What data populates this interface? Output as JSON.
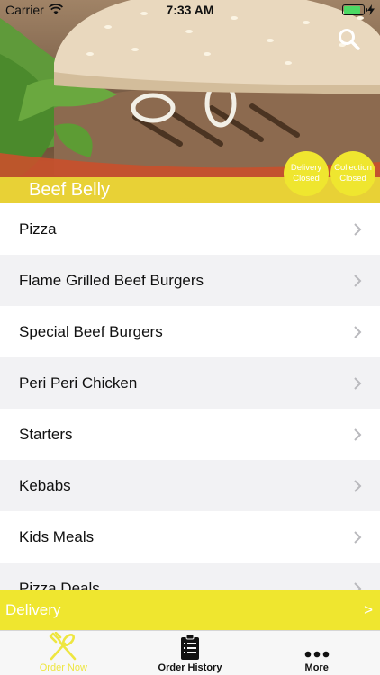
{
  "status_bar": {
    "carrier": "Carrier",
    "time": "7:33 AM"
  },
  "header": {
    "restaurant_name": "Beef Belly",
    "delivery_badge": {
      "line1": "Delivery",
      "line2": "Closed"
    },
    "collection_badge": {
      "line1": "Collection",
      "line2": "Closed"
    },
    "search_icon": "search-icon"
  },
  "menu": {
    "items": [
      {
        "label": "Pizza"
      },
      {
        "label": "Flame Grilled Beef Burgers"
      },
      {
        "label": "Special Beef Burgers"
      },
      {
        "label": "Peri Peri Chicken"
      },
      {
        "label": "Starters"
      },
      {
        "label": "Kebabs"
      },
      {
        "label": "Kids Meals"
      },
      {
        "label": "Pizza Deals"
      }
    ]
  },
  "delivery_bar": {
    "label": "Delivery",
    "arrow": ">"
  },
  "tabs": [
    {
      "label": "Order Now",
      "icon": "fork-knife-icon",
      "active": true
    },
    {
      "label": "Order History",
      "icon": "clipboard-icon",
      "active": false
    },
    {
      "label": "More",
      "icon": "more-dots-icon",
      "active": false
    }
  ],
  "colors": {
    "accent": "#efe62f",
    "alt_row": "#f2f2f4"
  }
}
